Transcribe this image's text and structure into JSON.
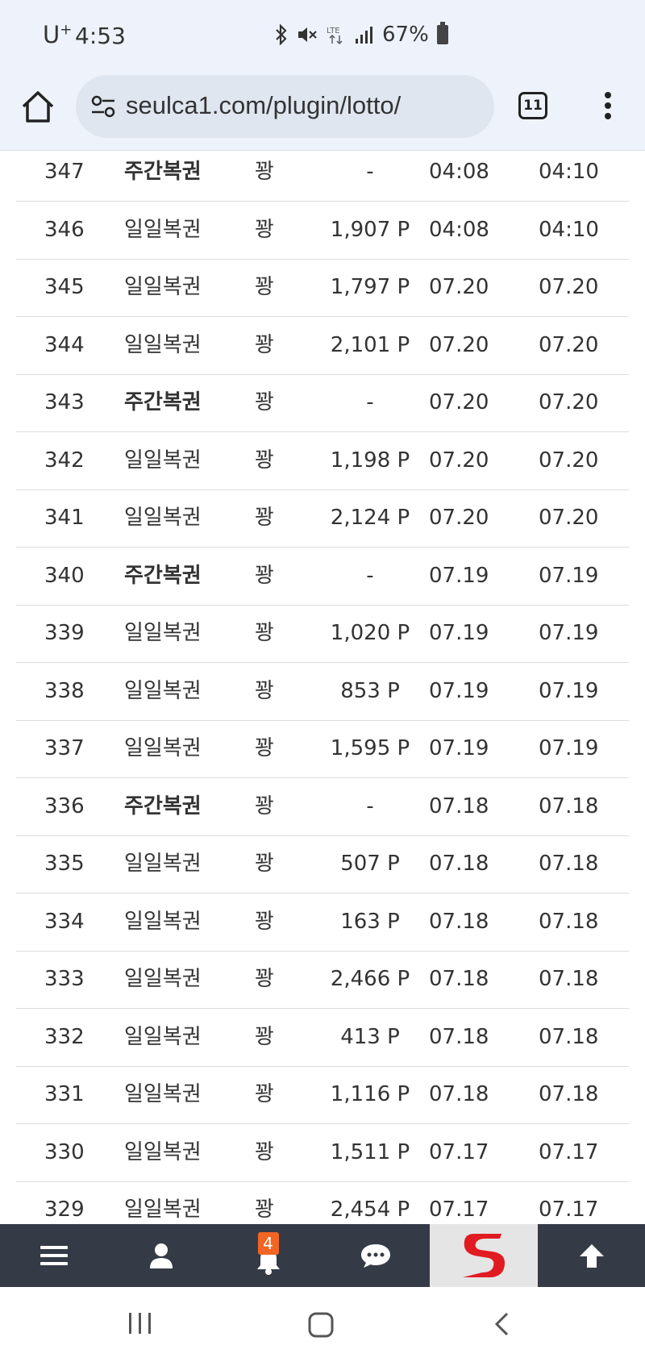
{
  "status": {
    "carrier": "U",
    "carrier_sup": "+",
    "time": "4:53",
    "battery": "67%"
  },
  "browser": {
    "url": "seulca1.com/plugin/lotto/",
    "tab_count": "11"
  },
  "rows": [
    {
      "no": "347",
      "type": "주간복권",
      "weekly": true,
      "result": "꽝",
      "points": "-",
      "date1": "04:08",
      "date2": "04:10"
    },
    {
      "no": "346",
      "type": "일일복권",
      "weekly": false,
      "result": "꽝",
      "points": "1,907 P",
      "date1": "04:08",
      "date2": "04:10"
    },
    {
      "no": "345",
      "type": "일일복권",
      "weekly": false,
      "result": "꽝",
      "points": "1,797 P",
      "date1": "07.20",
      "date2": "07.20"
    },
    {
      "no": "344",
      "type": "일일복권",
      "weekly": false,
      "result": "꽝",
      "points": "2,101 P",
      "date1": "07.20",
      "date2": "07.20"
    },
    {
      "no": "343",
      "type": "주간복권",
      "weekly": true,
      "result": "꽝",
      "points": "-",
      "date1": "07.20",
      "date2": "07.20"
    },
    {
      "no": "342",
      "type": "일일복권",
      "weekly": false,
      "result": "꽝",
      "points": "1,198 P",
      "date1": "07.20",
      "date2": "07.20"
    },
    {
      "no": "341",
      "type": "일일복권",
      "weekly": false,
      "result": "꽝",
      "points": "2,124 P",
      "date1": "07.20",
      "date2": "07.20"
    },
    {
      "no": "340",
      "type": "주간복권",
      "weekly": true,
      "result": "꽝",
      "points": "-",
      "date1": "07.19",
      "date2": "07.19"
    },
    {
      "no": "339",
      "type": "일일복권",
      "weekly": false,
      "result": "꽝",
      "points": "1,020 P",
      "date1": "07.19",
      "date2": "07.19"
    },
    {
      "no": "338",
      "type": "일일복권",
      "weekly": false,
      "result": "꽝",
      "points": "853 P",
      "date1": "07.19",
      "date2": "07.19"
    },
    {
      "no": "337",
      "type": "일일복권",
      "weekly": false,
      "result": "꽝",
      "points": "1,595 P",
      "date1": "07.19",
      "date2": "07.19"
    },
    {
      "no": "336",
      "type": "주간복권",
      "weekly": true,
      "result": "꽝",
      "points": "-",
      "date1": "07.18",
      "date2": "07.18"
    },
    {
      "no": "335",
      "type": "일일복권",
      "weekly": false,
      "result": "꽝",
      "points": "507 P",
      "date1": "07.18",
      "date2": "07.18"
    },
    {
      "no": "334",
      "type": "일일복권",
      "weekly": false,
      "result": "꽝",
      "points": "163 P",
      "date1": "07.18",
      "date2": "07.18"
    },
    {
      "no": "333",
      "type": "일일복권",
      "weekly": false,
      "result": "꽝",
      "points": "2,466 P",
      "date1": "07.18",
      "date2": "07.18"
    },
    {
      "no": "332",
      "type": "일일복권",
      "weekly": false,
      "result": "꽝",
      "points": "413 P",
      "date1": "07.18",
      "date2": "07.18"
    },
    {
      "no": "331",
      "type": "일일복권",
      "weekly": false,
      "result": "꽝",
      "points": "1,116 P",
      "date1": "07.18",
      "date2": "07.18"
    },
    {
      "no": "330",
      "type": "일일복권",
      "weekly": false,
      "result": "꽝",
      "points": "1,511 P",
      "date1": "07.17",
      "date2": "07.17"
    },
    {
      "no": "329",
      "type": "일일복권",
      "weekly": false,
      "result": "꽝",
      "points": "2,454 P",
      "date1": "07.17",
      "date2": "07.17"
    }
  ],
  "bottom_nav": {
    "notification_count": "4",
    "icons": [
      "hamburger-menu-icon",
      "user-icon",
      "bell-icon",
      "chat-icon",
      "site-logo",
      "arrow-up-icon"
    ]
  },
  "colors": {
    "nav_bg": "#343b47",
    "badge": "#f26522",
    "logo_red": "#e11b22",
    "status_bg": "#eef3fb"
  }
}
